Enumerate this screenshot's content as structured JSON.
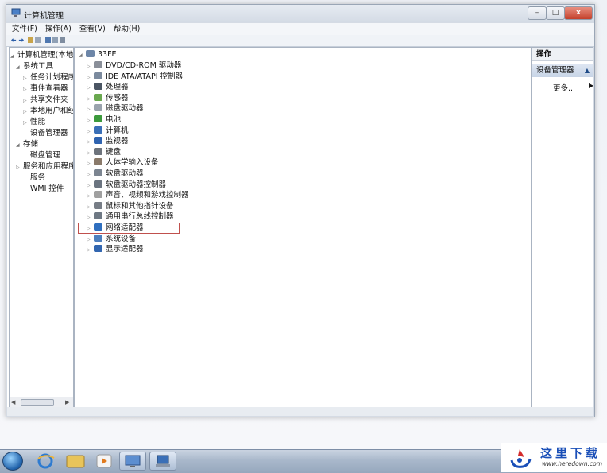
{
  "window": {
    "title": "计算机管理",
    "btn_min": "–",
    "btn_max": "□",
    "btn_close": "x"
  },
  "menu": [
    "文件(F)",
    "操作(A)",
    "查看(V)",
    "帮助(H)"
  ],
  "tree": [
    {
      "label": "计算机管理(本地",
      "arrow": "◢"
    },
    {
      "label": "系统工具",
      "arrow": "◢"
    },
    {
      "label": "任务计划程序",
      "arrow": "▷"
    },
    {
      "label": "事件查看器",
      "arrow": "▷"
    },
    {
      "label": "共享文件夹",
      "arrow": "▷"
    },
    {
      "label": "本地用户和组",
      "arrow": "▷"
    },
    {
      "label": "性能",
      "arrow": "▷"
    },
    {
      "label": "设备管理器",
      "arrow": ""
    },
    {
      "label": "存储",
      "arrow": "◢"
    },
    {
      "label": "磁盘管理",
      "arrow": ""
    },
    {
      "label": "服务和应用程序",
      "arrow": "▷"
    },
    {
      "label": "服务",
      "arrow": ""
    },
    {
      "label": "WMI 控件",
      "arrow": ""
    }
  ],
  "devices": {
    "root": "33FE",
    "root_arrow": "◢",
    "items": [
      {
        "label": "DVD/CD-ROM 驱动器",
        "color": "#8a8f99"
      },
      {
        "label": "IDE ATA/ATAPI 控制器",
        "color": "#7b8a9e"
      },
      {
        "label": "处理器",
        "color": "#4a5563"
      },
      {
        "label": "传感器",
        "color": "#6aa84f"
      },
      {
        "label": "磁盘驱动器",
        "color": "#9aa3ad"
      },
      {
        "label": "电池",
        "color": "#3c9a3c"
      },
      {
        "label": "计算机",
        "color": "#3a6fb7"
      },
      {
        "label": "监视器",
        "color": "#2f63b0"
      },
      {
        "label": "键盘",
        "color": "#6d737c"
      },
      {
        "label": "人体学输入设备",
        "color": "#8a7a6a"
      },
      {
        "label": "软盘驱动器",
        "color": "#7c8591"
      },
      {
        "label": "软盘驱动器控制器",
        "color": "#6b7480"
      },
      {
        "label": "声音、视频和游戏控制器",
        "color": "#a0a0a0"
      },
      {
        "label": "鼠标和其他指针设备",
        "color": "#777d86"
      },
      {
        "label": "通用串行总线控制器",
        "color": "#6e7884"
      },
      {
        "label": "网络适配器",
        "color": "#2f6fbf"
      },
      {
        "label": "系统设备",
        "color": "#4e7fbe"
      },
      {
        "label": "显示适配器",
        "color": "#3266b0"
      }
    ],
    "item_arrow": "▷"
  },
  "actions": {
    "header": "操作",
    "section": "设备管理器",
    "section_arrow": "▲",
    "more": "更多...",
    "more_arrow": "▶"
  },
  "colors": {
    "accent": "#1d5fa8",
    "highlight_border": "#c0504d",
    "watermark": "#1a4fb8"
  },
  "watermark": {
    "text": "这里下载",
    "url": "www.heredown.com"
  }
}
